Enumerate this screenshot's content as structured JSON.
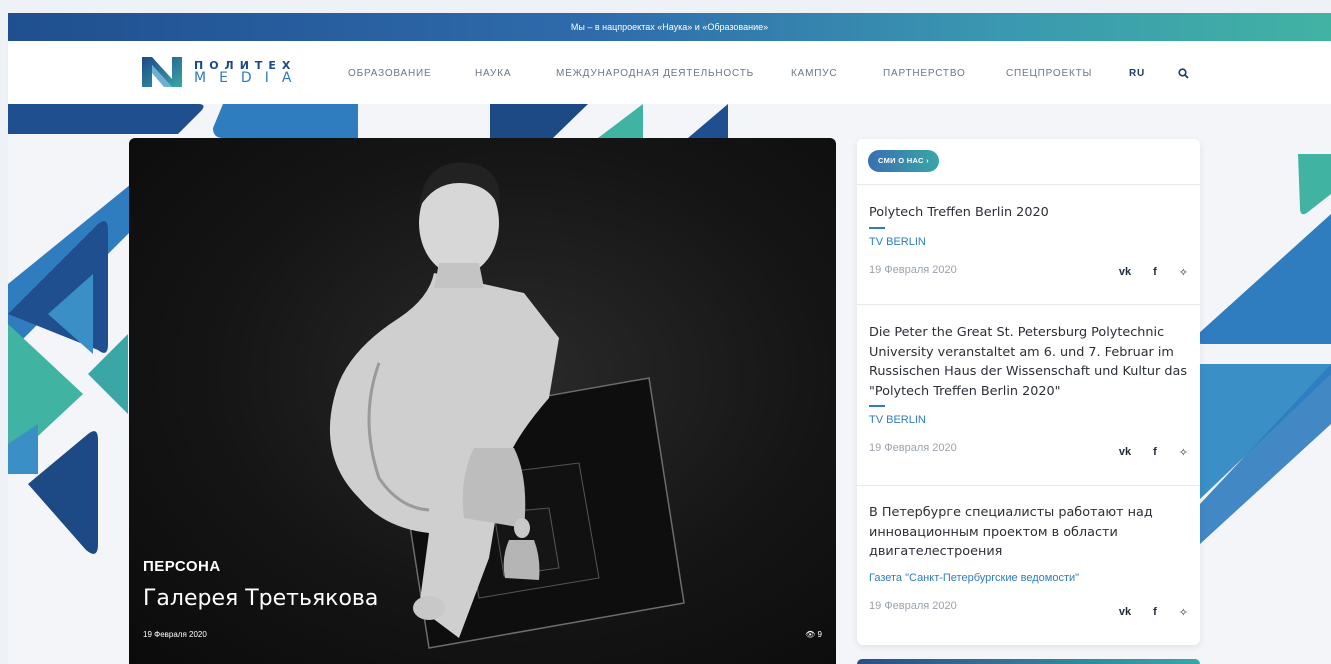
{
  "topbar": {
    "text": "Мы – в нацпроектах «Наука» и «Образование»"
  },
  "logo": {
    "top": "ПОЛИТЕХ",
    "bottom": "MEDIA"
  },
  "menu": {
    "items": [
      "ОБРАЗОВАНИЕ",
      "НАУКА",
      "МЕЖДУНАРОДНАЯ ДЕЯТЕЛЬНОСТЬ",
      "КАМПУС",
      "ПАРТНЕРСТВО",
      "СПЕЦПРОЕКТЫ"
    ],
    "lang": "RU"
  },
  "hero": {
    "tag": "ПЕРСОНА",
    "title": "Галерея Третьякова",
    "date": "19 Февраля 2020",
    "views": "9"
  },
  "sidebar": {
    "badge": "СМИ О НАС",
    "items": [
      {
        "title": "Polytech Treffen Berlin 2020",
        "source": "TV BERLIN",
        "date": "19 Февраля 2020"
      },
      {
        "title": "Die Peter the Great St. Petersburg Polytechnic University veranstaltet am 6. und 7. Februar im Russischen Haus der Wissenschaft und Kultur das \"Polytech Treffen Berlin 2020\"",
        "source": "TV BERLIN",
        "date": "19 Февраля 2020"
      },
      {
        "title": "В Петербурге специалисты работают над инновационным проектом в области двигателестроения",
        "source": "Газета \"Санкт-Петербургские ведомости\"",
        "date": "19 Февраля 2020"
      }
    ]
  },
  "colors": {
    "brand_dark": "#1f4f8f",
    "brand_blue": "#2f7cbf",
    "brand_teal": "#41b3a3"
  },
  "icons": {
    "search": "search-icon",
    "vk": "vk-icon",
    "facebook": "facebook-icon",
    "twitter": "twitter-icon",
    "eye": "eye-icon"
  }
}
